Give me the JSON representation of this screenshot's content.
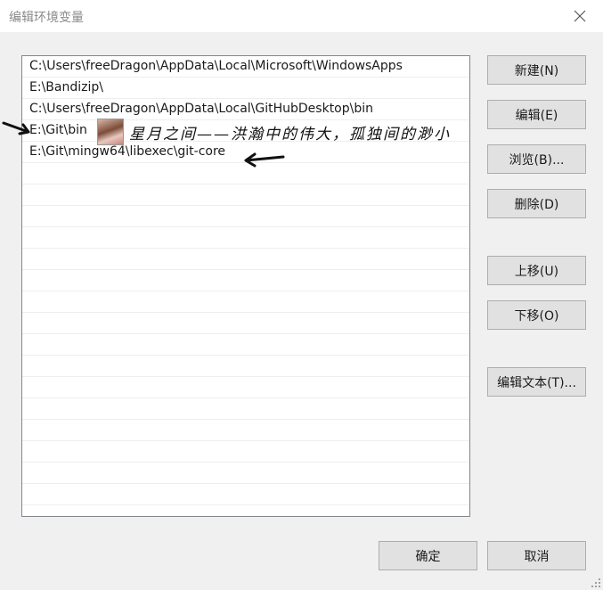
{
  "window": {
    "title": "编辑环境变量"
  },
  "paths": [
    "C:\\Users\\freeDragon\\AppData\\Local\\Microsoft\\WindowsApps",
    "E:\\Bandizip\\",
    "C:\\Users\\freeDragon\\AppData\\Local\\GitHubDesktop\\bin",
    "E:\\Git\\bin",
    "E:\\Git\\mingw64\\libexec\\git-core"
  ],
  "annotation": {
    "text": "星月之间——洪瀚中的伟大，孤独间的渺小"
  },
  "buttons": {
    "new": "新建(N)",
    "edit": "编辑(E)",
    "browse": "浏览(B)...",
    "delete": "删除(D)",
    "move_up": "上移(U)",
    "move_down": "下移(O)",
    "edit_text": "编辑文本(T)...",
    "ok": "确定",
    "cancel": "取消"
  },
  "icons": {
    "close": "close-icon",
    "arrow": "hand-drawn-arrow-icon",
    "avatar": "avatar-image"
  }
}
